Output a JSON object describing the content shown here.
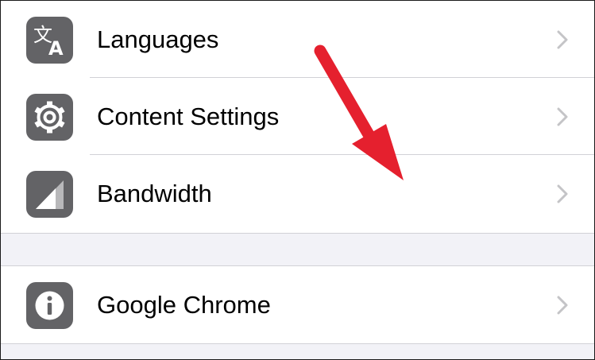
{
  "settings": {
    "group1": [
      {
        "label": "Languages",
        "icon": "translate-icon"
      },
      {
        "label": "Content Settings",
        "icon": "gear-icon"
      },
      {
        "label": "Bandwidth",
        "icon": "bandwidth-signal-icon"
      }
    ],
    "group2": [
      {
        "label": "Google Chrome",
        "icon": "info-icon"
      }
    ]
  },
  "colors": {
    "icon_background": "#636366",
    "chevron": "#c4c4c7",
    "separator": "#d1d1d6",
    "group_gap": "#f2f2f7",
    "annotation_arrow": "#e5202e"
  }
}
